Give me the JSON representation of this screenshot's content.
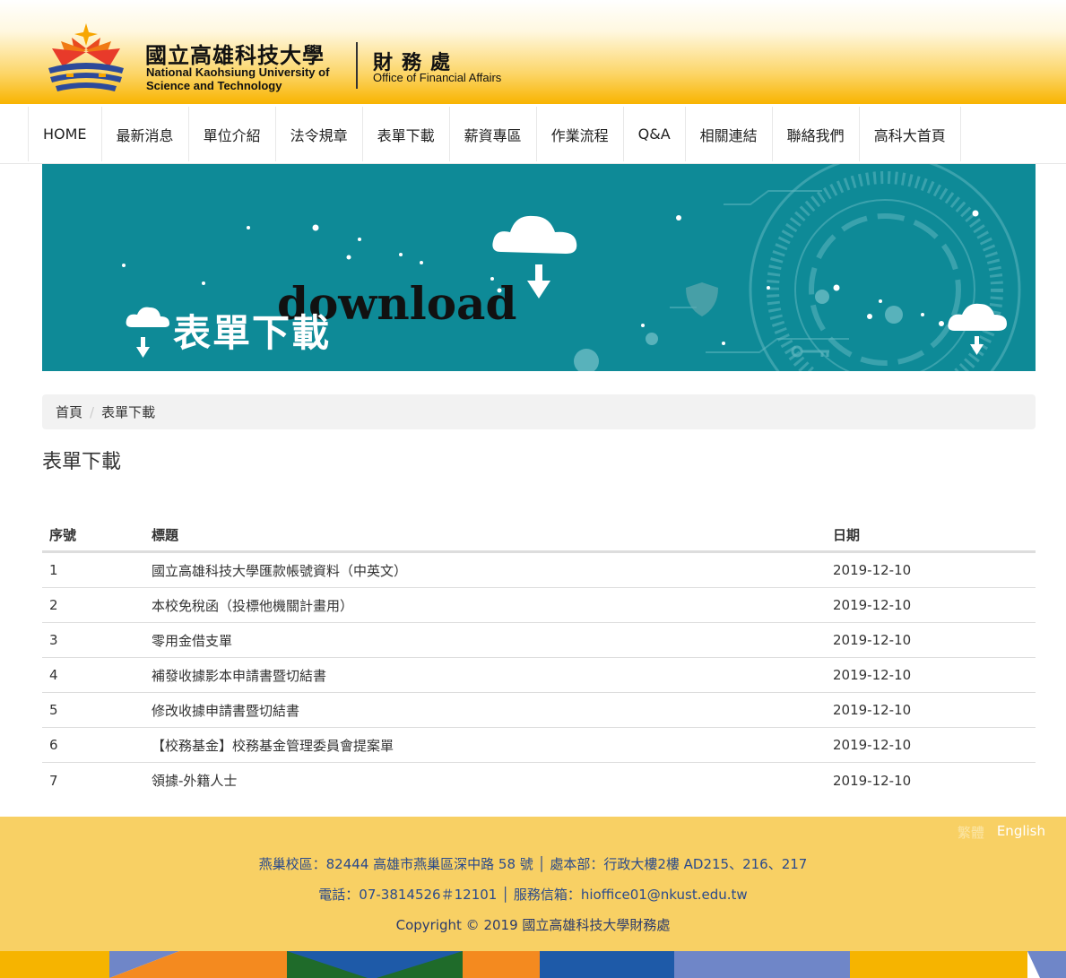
{
  "header": {
    "school_cn": "國立高雄科技大學",
    "school_en_line1": "National Kaohsiung University of",
    "school_en_line2": "Science and Technology",
    "office_cn": "財務處",
    "office_en": "Office of Financial Affairs"
  },
  "nav": {
    "items": [
      {
        "label": "HOME"
      },
      {
        "label": "最新消息"
      },
      {
        "label": "單位介紹"
      },
      {
        "label": "法令規章"
      },
      {
        "label": "表單下載"
      },
      {
        "label": "薪資專區"
      },
      {
        "label": "作業流程"
      },
      {
        "label": "Q&A"
      },
      {
        "label": "相關連結"
      },
      {
        "label": "聯絡我們"
      },
      {
        "label": "高科大首頁"
      }
    ]
  },
  "banner": {
    "title": "表單下載",
    "word": "download"
  },
  "breadcrumb": {
    "home": "首頁",
    "separator": "/",
    "current": "表單下載"
  },
  "page_title": "表單下載",
  "table": {
    "headers": [
      "序號",
      "標題",
      "日期"
    ],
    "rows": [
      {
        "no": "1",
        "title": "國立高雄科技大學匯款帳號資料（中英文）",
        "date": "2019-12-10"
      },
      {
        "no": "2",
        "title": "本校免稅函（投標他機關計畫用）",
        "date": "2019-12-10"
      },
      {
        "no": "3",
        "title": "零用金借支單",
        "date": "2019-12-10"
      },
      {
        "no": "4",
        "title": "補發收據影本申請書暨切結書",
        "date": "2019-12-10"
      },
      {
        "no": "5",
        "title": "修改收據申請書暨切結書",
        "date": "2019-12-10"
      },
      {
        "no": "6",
        "title": "【校務基金】校務基金管理委員會提案單",
        "date": "2019-12-10"
      },
      {
        "no": "7",
        "title": "領據-外籍人士",
        "date": "2019-12-10"
      }
    ]
  },
  "footer": {
    "lang_tw": "繁體",
    "lang_en": "English",
    "line1": "燕巢校區：82444 高雄市燕巢區深中路 58 號 │ 處本部：行政大樓2樓 AD215、216、217",
    "line2": "電話：07-3814526＃12101 │ 服務信箱：hioffice01@nkust.edu.tw",
    "line3": "Copyright © 2019 國立高雄科技大學財務處"
  },
  "colors": {
    "banner_bg": "#0e8a97",
    "header_gold": "#f8b400",
    "footer_bg": "#f8d064",
    "footer_text": "#2a4a8c"
  },
  "icons": [
    "school-logo-icon",
    "cloud-download-icon",
    "gear-icon",
    "shield-icon",
    "key-icon"
  ]
}
